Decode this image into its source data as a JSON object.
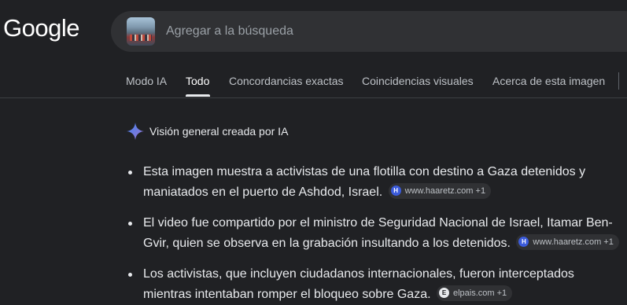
{
  "header": {
    "logo_text": "Google",
    "search": {
      "placeholder": "Agregar a la búsqueda"
    }
  },
  "tabs": [
    {
      "label": "Modo IA",
      "active": false
    },
    {
      "label": "Todo",
      "active": true
    },
    {
      "label": "Concordancias exactas",
      "active": false
    },
    {
      "label": "Coincidencias visuales",
      "active": false
    },
    {
      "label": "Acerca de esta imagen",
      "active": false
    }
  ],
  "ai_overview": {
    "title": "Visión general creada por IA",
    "bullets": [
      {
        "text": "Esta imagen muestra a activistas de una flotilla con destino a Gaza detenidos y maniatados en el puerto de Ashdod, Israel.",
        "source": {
          "label": "www.haaretz.com +1",
          "icon": "haaretz-icon"
        }
      },
      {
        "text": "El video fue compartido por el ministro de Seguridad Nacional de Israel, Itamar Ben-Gvir, quien se observa en la grabación insultando a los detenidos.",
        "source": {
          "label": "www.haaretz.com +1",
          "icon": "haaretz-icon"
        }
      },
      {
        "text": "Los activistas, que incluyen ciudadanos internacionales, fueron interceptados mientras intentaban romper el bloqueo sobre Gaza.",
        "source": {
          "label": "elpais.com +1",
          "icon": "elpais-icon"
        }
      }
    ]
  },
  "colors": {
    "background": "#202124",
    "search_bg": "#303134",
    "text": "#e8eaed",
    "muted": "#bdc1c6",
    "sparkle": "#4285f4"
  }
}
